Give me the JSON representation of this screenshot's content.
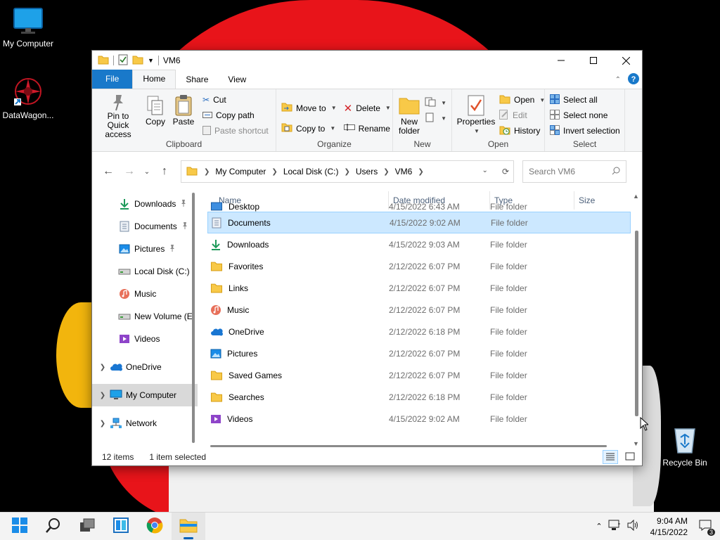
{
  "desktop": {
    "icons": [
      {
        "label": "My Computer",
        "icon": "monitor-icon"
      },
      {
        "label": "DataWagon...",
        "icon": "datawagon-icon"
      },
      {
        "label": "Recycle Bin",
        "icon": "recycle-bin-icon"
      }
    ]
  },
  "window": {
    "title": "VM6",
    "tabs": {
      "file": "File",
      "home": "Home",
      "share": "Share",
      "view": "View"
    },
    "ribbon": {
      "clipboard": {
        "label": "Clipboard",
        "pin_line1": "Pin to Quick",
        "pin_line2": "access",
        "copy": "Copy",
        "paste": "Paste",
        "cut": "Cut",
        "copy_path": "Copy path",
        "paste_shortcut": "Paste shortcut"
      },
      "organize": {
        "label": "Organize",
        "move_to": "Move to",
        "copy_to": "Copy to",
        "delete": "Delete",
        "rename": "Rename"
      },
      "new": {
        "label": "New",
        "new_folder_line1": "New",
        "new_folder_line2": "folder"
      },
      "open": {
        "label": "Open",
        "properties": "Properties",
        "open": "Open",
        "edit": "Edit",
        "history": "History"
      },
      "select": {
        "label": "Select",
        "select_all": "Select all",
        "select_none": "Select none",
        "invert_selection": "Invert selection"
      }
    },
    "address": {
      "crumbs": [
        "My Computer",
        "Local Disk (C:)",
        "Users",
        "VM6"
      ]
    },
    "search": {
      "placeholder": "Search VM6"
    },
    "nav_pane": [
      {
        "label": "Downloads",
        "icon": "download-icon",
        "pinned": true
      },
      {
        "label": "Documents",
        "icon": "documents-icon",
        "pinned": true
      },
      {
        "label": "Pictures",
        "icon": "pictures-icon",
        "pinned": true
      },
      {
        "label": "Local Disk (C:)",
        "icon": "drive-icon",
        "pinned": false
      },
      {
        "label": "Music",
        "icon": "music-icon",
        "pinned": false
      },
      {
        "label": "New Volume (E",
        "icon": "drive-icon",
        "pinned": false
      },
      {
        "label": "Videos",
        "icon": "videos-icon",
        "pinned": false
      },
      {
        "label": "OneDrive",
        "icon": "onedrive-icon",
        "expandable": true
      },
      {
        "label": "My Computer",
        "icon": "monitor-icon",
        "expandable": true,
        "selected": true
      },
      {
        "label": "Network",
        "icon": "network-icon",
        "expandable": true
      }
    ],
    "columns": {
      "name": "Name",
      "date": "Date modified",
      "type": "Type",
      "size": "Size"
    },
    "files": [
      {
        "name": "Desktop",
        "date": "4/15/2022 6:43 AM",
        "type": "File folder",
        "icon": "desktop-folder-icon"
      },
      {
        "name": "Documents",
        "date": "4/15/2022 9:02 AM",
        "type": "File folder",
        "icon": "documents-icon",
        "selected": true
      },
      {
        "name": "Downloads",
        "date": "4/15/2022 9:03 AM",
        "type": "File folder",
        "icon": "download-icon"
      },
      {
        "name": "Favorites",
        "date": "2/12/2022 6:07 PM",
        "type": "File folder",
        "icon": "folder-icon"
      },
      {
        "name": "Links",
        "date": "2/12/2022 6:07 PM",
        "type": "File folder",
        "icon": "folder-icon"
      },
      {
        "name": "Music",
        "date": "2/12/2022 6:07 PM",
        "type": "File folder",
        "icon": "music-icon"
      },
      {
        "name": "OneDrive",
        "date": "2/12/2022 6:18 PM",
        "type": "File folder",
        "icon": "onedrive-icon"
      },
      {
        "name": "Pictures",
        "date": "2/12/2022 6:07 PM",
        "type": "File folder",
        "icon": "pictures-icon"
      },
      {
        "name": "Saved Games",
        "date": "2/12/2022 6:07 PM",
        "type": "File folder",
        "icon": "folder-icon"
      },
      {
        "name": "Searches",
        "date": "2/12/2022 6:18 PM",
        "type": "File folder",
        "icon": "folder-icon"
      },
      {
        "name": "Videos",
        "date": "4/15/2022 9:02 AM",
        "type": "File folder",
        "icon": "videos-icon"
      }
    ],
    "status": {
      "items": "12 items",
      "selected": "1 item selected"
    }
  },
  "taskbar": {
    "time": "9:04 AM",
    "date": "4/15/2022",
    "notification_count": "3"
  },
  "colors": {
    "file_tab": "#1979ca",
    "selection_bg": "#cce8ff",
    "selection_border": "#99d1ff",
    "folder_yellow": "#f8c948"
  }
}
